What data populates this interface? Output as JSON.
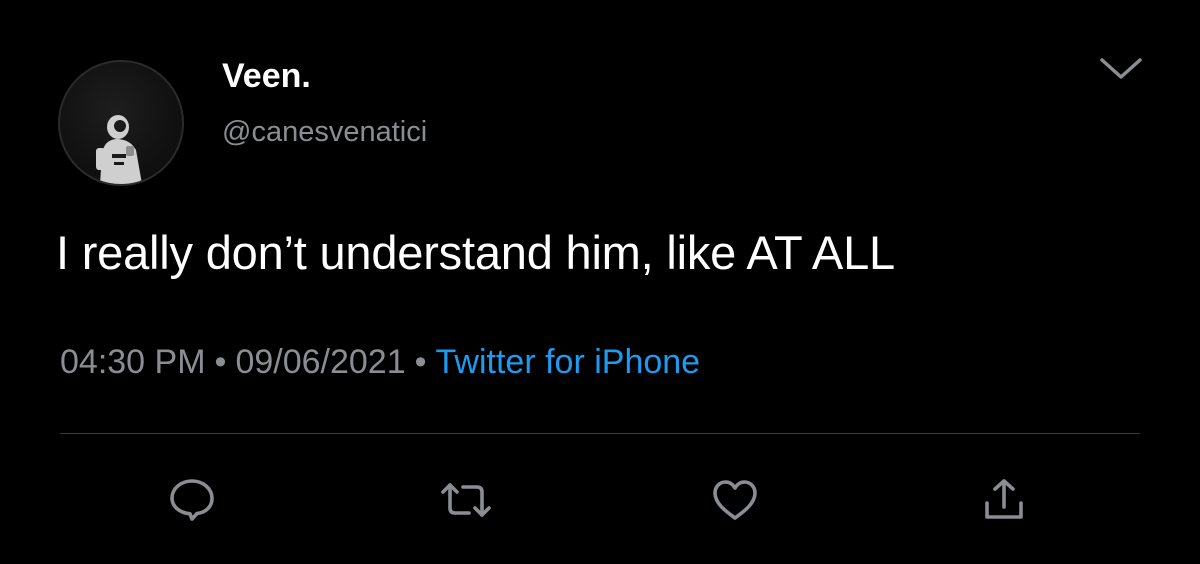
{
  "tweet": {
    "author": {
      "display_name": "Veen.",
      "handle": "@canesvenatici"
    },
    "text": "I really don’t understand him, like AT ALL",
    "time": "04:30 PM",
    "date": "09/06/2021",
    "separator": "•",
    "source": "Twitter for iPhone"
  },
  "actions": {
    "reply_icon": "reply-icon",
    "retweet_icon": "retweet-icon",
    "like_icon": "heart-icon",
    "share_icon": "share-icon"
  },
  "colors": {
    "background": "#000000",
    "text_primary": "#ffffff",
    "text_secondary": "#8a8d91",
    "link": "#1d9bf0",
    "divider": "#3b3d40"
  }
}
